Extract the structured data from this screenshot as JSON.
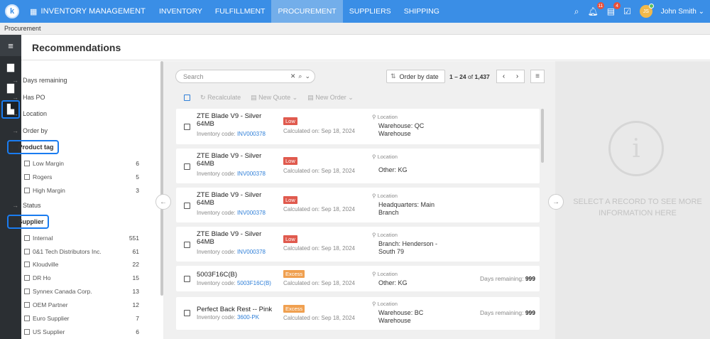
{
  "app": {
    "logo": "k",
    "title": "INVENTORY MANAGEMENT"
  },
  "nav": [
    "INVENTORY",
    "FULFILLMENT",
    "PROCUREMENT",
    "SUPPLIERS",
    "SHIPPING"
  ],
  "top": {
    "bell_count": "11",
    "cal_count": "4",
    "avatar": "JS",
    "user": "John Smith"
  },
  "breadcrumb": "Procurement",
  "page_title": "Recommendations",
  "filters": {
    "days": "Days remaining",
    "has_po": "Has PO",
    "location": "Location",
    "order_by": "Order by",
    "product_tag": "Product tag",
    "product_tag_items": [
      {
        "label": "Low Margin",
        "count": "6"
      },
      {
        "label": "Rogers",
        "count": "5"
      },
      {
        "label": "High Margin",
        "count": "3"
      }
    ],
    "status": "Status",
    "supplier": "Supplier",
    "supplier_items": [
      {
        "label": "Internal",
        "count": "551"
      },
      {
        "label": "0&1 Tech Distributors Inc.",
        "count": "61"
      },
      {
        "label": "Kloudville",
        "count": "22"
      },
      {
        "label": "DR Ho",
        "count": "15"
      },
      {
        "label": "Synnex Canada Corp.",
        "count": "13"
      },
      {
        "label": "OEM Partner",
        "count": "12"
      },
      {
        "label": "Euro Supplier",
        "count": "7"
      },
      {
        "label": "US Supplier",
        "count": "6"
      }
    ]
  },
  "search": {
    "placeholder": "Search"
  },
  "order_by": "Order by date",
  "pager": {
    "range": "1 – 24",
    "of": "of",
    "total": "1,437"
  },
  "toolbar": {
    "recalc": "Recalculate",
    "new_quote": "New Quote",
    "new_order": "New Order"
  },
  "cards": [
    {
      "name": "ZTE Blade V9 - Silver 64MB",
      "code_label": "Inventory code:",
      "code": "INV000378",
      "tag": "Low",
      "calc": "Calculated on: Sep 18, 2024",
      "loc_label": "Location",
      "loc": "Warehouse: QC Warehouse",
      "days_label": "",
      "days": ""
    },
    {
      "name": "ZTE Blade V9 - Silver 64MB",
      "code_label": "Inventory code:",
      "code": "INV000378",
      "tag": "Low",
      "calc": "Calculated on: Sep 18, 2024",
      "loc_label": "Location",
      "loc": "Other: KG",
      "days_label": "",
      "days": ""
    },
    {
      "name": "ZTE Blade V9 - Silver 64MB",
      "code_label": "Inventory code:",
      "code": "INV000378",
      "tag": "Low",
      "calc": "Calculated on: Sep 18, 2024",
      "loc_label": "Location",
      "loc": "Headquarters: Main Branch",
      "days_label": "",
      "days": ""
    },
    {
      "name": "ZTE Blade V9 - Silver 64MB",
      "code_label": "Inventory code:",
      "code": "INV000378",
      "tag": "Low",
      "calc": "Calculated on: Sep 18, 2024",
      "loc_label": "Location",
      "loc": "Branch: Henderson - South 79",
      "days_label": "",
      "days": ""
    },
    {
      "name": "5003F16C(B)",
      "code_label": "Inventory code:",
      "code": "5003F16C(B)",
      "tag": "Excess",
      "calc": "Calculated on: Sep 18, 2024",
      "loc_label": "Location",
      "loc": "Other: KG",
      "days_label": "Days remaining:",
      "days": "999"
    },
    {
      "name": "Perfect Back Rest -- Pink",
      "code_label": "Inventory code:",
      "code": "3600-PK",
      "tag": "Excess",
      "calc": "Calculated on: Sep 18, 2024",
      "loc_label": "Location",
      "loc": "Warehouse: BC Warehouse",
      "days_label": "Days remaining:",
      "days": "999"
    }
  ],
  "detail": {
    "text": "SELECT A RECORD TO SEE MORE INFORMATION HERE"
  }
}
